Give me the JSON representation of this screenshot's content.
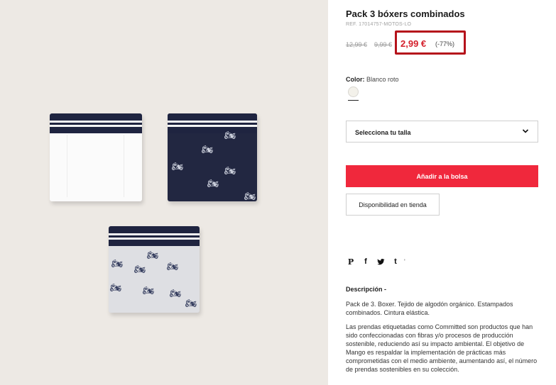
{
  "product": {
    "title": "Pack 3 bóxers combinados",
    "ref": "REF. 17014757-MOTOS-LO",
    "old_price_1": "12,99 €",
    "old_price_2": "9,99 €",
    "price": "2,99 €",
    "discount": "(-77%)",
    "price_color": "#d41f2b",
    "highlight_color": "#b5121b"
  },
  "color": {
    "label": "Color:",
    "value": "Blanco roto",
    "swatch_hex": "#f3f1ea"
  },
  "size": {
    "placeholder": "Selecciona tu talla",
    "icon": "chevron-down-icon"
  },
  "actions": {
    "add_to_bag": "Añadir a la bolsa",
    "add_color": "#f0283c",
    "store_availability": "Disponibilidad en tienda"
  },
  "social": {
    "icons": [
      "pinterest-icon",
      "facebook-icon",
      "twitter-icon",
      "tumblr-icon"
    ],
    "pinterest": "P",
    "facebook": "f",
    "tumblr": "t",
    "more": "'"
  },
  "description": {
    "title": "Descripción  -",
    "paragraph_1": "Pack de 3. Boxer. Tejido de algodón orgánico. Estampados combinados. Cintura elástica.",
    "paragraph_2": "Las prendas etiquetadas como Committed son productos que han sido confeccionadas con fibras y/o procesos de producción sostenible, reduciendo así su impacto ambiental. El objetivo de Mango es respaldar la implementación de prácticas más comprometidas con el medio ambiente, aumentando así, el número de prendas sostenibles en su colección."
  },
  "image": {
    "background": "#ede9e4",
    "items": [
      "white-boxer",
      "navy-moto-boxer",
      "grey-moto-boxer"
    ]
  }
}
